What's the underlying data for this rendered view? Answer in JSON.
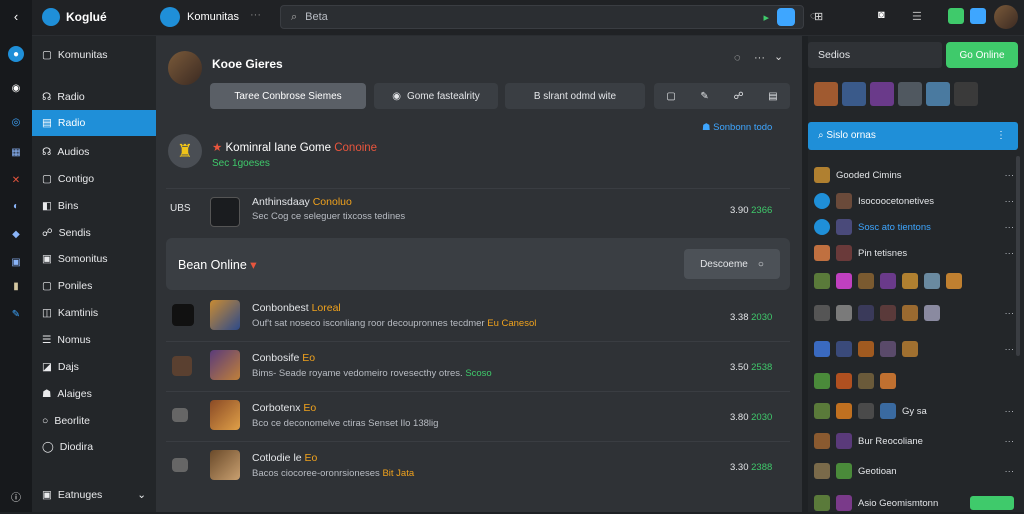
{
  "app": {
    "logo": "Koglué",
    "title": "Komunitas"
  },
  "search": {
    "placeholder": "Beta"
  },
  "nav": {
    "header": "Komunitas",
    "items": [
      "Radio",
      "Radio",
      "Audios",
      "Contigo",
      "Bins",
      "Sendis",
      "Somonitus",
      "Poniles",
      "Kamtinis",
      "Nomus",
      "Dajs",
      "Alaiges",
      "Beorlite",
      "Diodira"
    ],
    "footer": "Eatnuges"
  },
  "profile": {
    "name": "Kooe Gieres",
    "tabs": [
      "Taree  Conbrose Siemes",
      "Gome fastealrity",
      "B slrant odmd wite"
    ]
  },
  "post": {
    "title": "Kominral Iane",
    "game": "Gome",
    "status": "Conoine",
    "sub": "Sec 1goeses"
  },
  "link": {
    "label": "Sonbonn todo"
  },
  "entry0": {
    "tag": "UBS",
    "title": "Anthinsdaay",
    "tag2": "Conoluo",
    "sub": "Sec Cog ce seleguer tixcoss tedines",
    "meta1": "3.90",
    "meta2": "2366"
  },
  "section": {
    "title": "Bean Online",
    "btn": "Descoeme"
  },
  "feed": [
    {
      "title": "Conbonbest",
      "tag": "Loreal",
      "sub": "Ouf't sat noseco isconliang roor decoupronnes tecdmer",
      "tag2": "Eu Canesol",
      "meta1": "3.38",
      "meta2": "2030"
    },
    {
      "title": "Conbosife",
      "tag": "Eo",
      "sub": "Bims- Seade royame vedomeiro rovesecthy otres.",
      "tag2": "Scoso",
      "meta1": "3.50",
      "meta2": "2538"
    },
    {
      "title": "Corbotenx",
      "tag": "Eo",
      "sub": "Bco ce deconomelve ctiras Senset Ilo 138lig",
      "tag2": "",
      "meta1": "3.80",
      "meta2": "2030"
    },
    {
      "title": "Cotlodie le",
      "tag": "Eo",
      "sub": "Bacos ciocoree-oronrsioneses",
      "tag2": "Bit Jata",
      "meta1": "3.30",
      "meta2": "2388"
    }
  ],
  "side": {
    "header": "Sedios",
    "btn": "Go Online",
    "banner": "Sislo ornas",
    "list": [
      "Gooded Cimins",
      "Isocoocetonetives",
      "Sosc ato tientons",
      "Pin tetisnes",
      "",
      "",
      "",
      "",
      "",
      "Gy sa",
      "Bur Reocoliane",
      "Geotioan",
      "Asio Geomismtonn"
    ]
  },
  "colors": {
    "accent": "#1f8fd8",
    "green": "#3fca6b",
    "orange": "#f0a21d",
    "red": "#e8553d",
    "bg": "#2f3236"
  }
}
